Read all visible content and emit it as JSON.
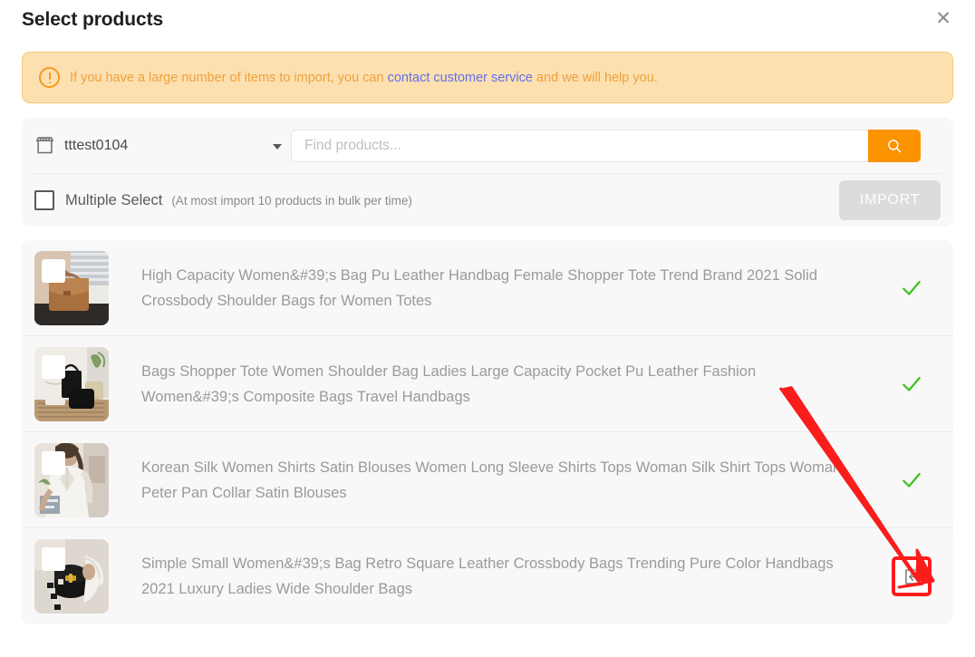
{
  "header": {
    "title": "Select products",
    "close_label": "✕"
  },
  "alert": {
    "icon": "exclamation-circle-icon",
    "text_before": "If you have a large number of items to import, you can ",
    "link_text": "contact customer service",
    "text_after": " and we will help you.",
    "bg_color": "#fce0b0",
    "text_color": "#f0a13c",
    "link_color": "#6370e8"
  },
  "toolbar": {
    "store_icon": "storefront-icon",
    "store_name": "tttest0104",
    "search_placeholder": "Find products...",
    "search_value": "",
    "search_icon": "search-icon",
    "search_button_color": "#fb9200",
    "multiple_select_label": "Multiple Select",
    "multiple_select_hint": "(At most import 10 products in bulk per time)",
    "multiple_select_checked": false,
    "import_label": "IMPORT",
    "import_disabled": true,
    "import_bg_color": "#dcdcdc"
  },
  "products": [
    {
      "title": "High Capacity Women&#39;s Bag Pu Leather Handbag Female Shopper Tote Trend Brand 2021 Solid Crossbody Shoulder Bags for Women Totes",
      "action": "check",
      "action_icon": "green-check-icon",
      "thumb_alt": "brown-leather-tote-bag"
    },
    {
      "title": "Bags Shopper Tote Women Shoulder Bag Ladies Large Capacity Pocket Pu Leather Fashion Women&#39;s Composite Bags Travel Handbags",
      "action": "check",
      "action_icon": "green-check-icon",
      "thumb_alt": "black-tote-and-pouch-bags"
    },
    {
      "title": "Korean Silk Women Shirts Satin Blouses Women Long Sleeve Shirts Tops Woman Silk Shirt Tops Woman Peter Pan Collar Satin Blouses",
      "action": "check",
      "action_icon": "green-check-icon",
      "thumb_alt": "woman-in-white-satin-blouse"
    },
    {
      "title": "Simple Small Women&#39;s Bag Retro Square Leather Crossbody Bags Trending Pure Color Handbags 2021 Luxury Ladies Wide Shoulder Bags",
      "action": "import",
      "action_icon": "import-arrow-icon",
      "thumb_alt": "black-square-crossbody-bag"
    }
  ],
  "annotation": {
    "arrow_color": "#fb1c1c",
    "highlight_color": "#fb1c1c"
  },
  "colors": {
    "accent": "#fb9200",
    "check_green": "#3ec01e",
    "panel_bg": "#f8f8f8"
  }
}
